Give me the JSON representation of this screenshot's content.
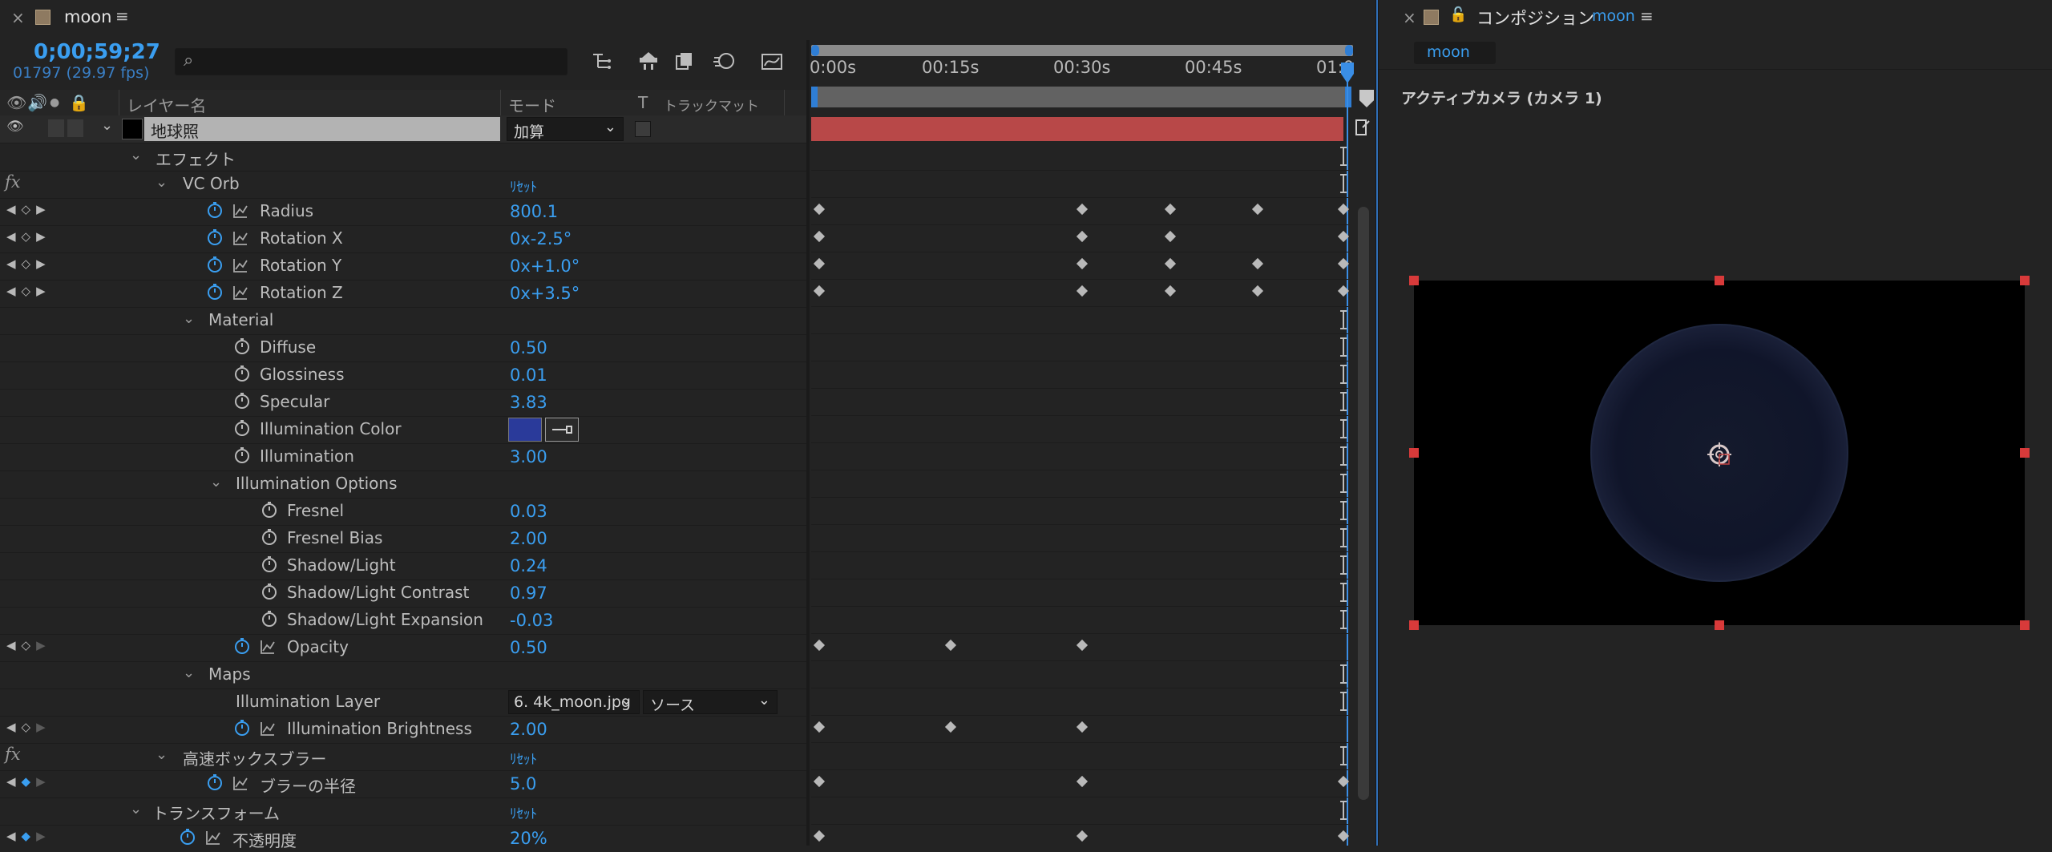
{
  "timeline": {
    "tab": {
      "close": "×",
      "title": "moon",
      "menu": "≡"
    },
    "timecode": "0;00;59;27",
    "frames": "01797 (29.97 fps)",
    "search_placeholder": "",
    "column_headers": {
      "layer_name": "レイヤー名",
      "mode": "モード",
      "t": "T",
      "track_matte": "トラックマット"
    },
    "layer": {
      "name": "地球照",
      "mode": "加算"
    },
    "rows": {
      "effects": "エフェクト",
      "vc_orb": "VC Orb",
      "vc_orb_reset": "ﾘｾｯﾄ",
      "radius": {
        "name": "Radius",
        "value": "800.1"
      },
      "rot_x": {
        "name": "Rotation X",
        "value": "0x-2.5°"
      },
      "rot_y": {
        "name": "Rotation Y",
        "value": "0x+1.0°"
      },
      "rot_z": {
        "name": "Rotation Z",
        "value": "0x+3.5°"
      },
      "material": "Material",
      "diffuse": {
        "name": "Diffuse",
        "value": "0.50"
      },
      "glossiness": {
        "name": "Glossiness",
        "value": "0.01"
      },
      "specular": {
        "name": "Specular",
        "value": "3.83"
      },
      "illum_color": {
        "name": "Illumination Color",
        "swatch": "#2a3a9a"
      },
      "illumination": {
        "name": "Illumination",
        "value": "3.00"
      },
      "illum_options": "Illumination Options",
      "fresnel": {
        "name": "Fresnel",
        "value": "0.03"
      },
      "fresnel_bias": {
        "name": "Fresnel Bias",
        "value": "2.00"
      },
      "shadow_light": {
        "name": "Shadow/Light",
        "value": "0.24"
      },
      "shadow_contrast": {
        "name": "Shadow/Light Contrast",
        "value": "0.97"
      },
      "shadow_expansion": {
        "name": "Shadow/Light Expansion",
        "value": "-0.03"
      },
      "opacity": {
        "name": "Opacity",
        "value": "0.50"
      },
      "maps": "Maps",
      "illum_layer": {
        "name": "Illumination Layer",
        "layer_value": "6. 4k_moon.jpg",
        "source_value": "ソース"
      },
      "illum_brightness": {
        "name": "Illumination Brightness",
        "value": "2.00"
      },
      "fast_blur": "高速ボックスブラー",
      "fast_blur_reset": "ﾘｾｯﾄ",
      "blur_radius": {
        "name": "ブラーの半径",
        "value": "5.0"
      },
      "transform": "トランスフォーム",
      "transform_reset": "ﾘｾｯﾄ",
      "opacity_jp": {
        "name": "不透明度",
        "value": "20%"
      }
    },
    "fx_label": "fx",
    "ruler": {
      "labels": [
        "0:00s",
        "00:15s",
        "00:30s",
        "00:45s",
        "01:0"
      ]
    }
  },
  "composition": {
    "tab": {
      "close": "×",
      "lock": "🔓",
      "title": "コンポジション",
      "name": "moon",
      "menu": "≡"
    },
    "subtab": "moon",
    "camera_label": "アクティブカメラ (カメラ 1)"
  },
  "colors": {
    "accent": "#3a9ef0",
    "layer_bar": "#b84848",
    "label_swatch": "#8e7a61"
  }
}
